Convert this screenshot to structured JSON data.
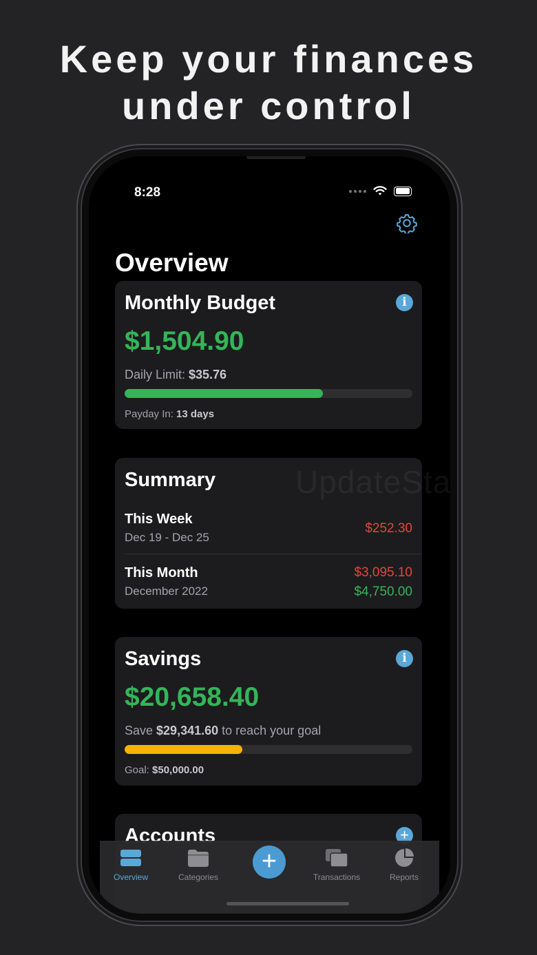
{
  "headline": {
    "line1": "Keep your finances",
    "line2": "under control"
  },
  "status": {
    "time": "8:28"
  },
  "page": {
    "title": "Overview"
  },
  "monthly_budget": {
    "title": "Monthly Budget",
    "amount": "$1,504.90",
    "daily_limit_label": "Daily Limit: ",
    "daily_limit_value": "$35.76",
    "progress": 0.69,
    "progress_color": "#34b559",
    "payday_label": "Payday In: ",
    "payday_value": "13 days"
  },
  "summary": {
    "title": "Summary",
    "watermark": "UpdateStar.com",
    "week": {
      "label": "This Week",
      "range": "Dec 19 - Dec 25",
      "spent": "$252.30"
    },
    "month": {
      "label": "This Month",
      "range": "December 2022",
      "spent": "$3,095.10",
      "income": "$4,750.00"
    }
  },
  "savings": {
    "title": "Savings",
    "amount": "$20,658.40",
    "save_prefix": "Save ",
    "save_amount": "$29,341.60",
    "save_suffix": " to reach your goal",
    "progress": 0.41,
    "progress_color": "#f5b400",
    "goal_label": "Goal: ",
    "goal_value": "$50,000.00"
  },
  "accounts": {
    "title": "Accounts"
  },
  "tabbar": {
    "items": [
      {
        "label": "Overview",
        "icon": "overview-icon",
        "active": true
      },
      {
        "label": "Categories",
        "icon": "folder-icon",
        "active": false
      },
      {
        "label": "Transactions",
        "icon": "transactions-icon",
        "active": false
      },
      {
        "label": "Reports",
        "icon": "pie-chart-icon",
        "active": false
      }
    ],
    "add_symbol": "+"
  },
  "colors": {
    "accent": "#5aa8d8",
    "positive": "#34b559",
    "negative": "#e2473c",
    "goal": "#f5b400"
  }
}
